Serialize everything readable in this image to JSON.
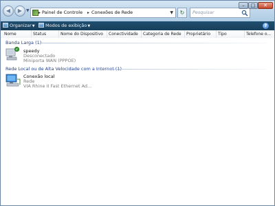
{
  "address_bar": {
    "segments": [
      "Painel de Controle",
      "Conexões de Rede"
    ]
  },
  "search": {
    "placeholder": "Pesquisar"
  },
  "toolbar": {
    "organize": "Organizar",
    "views": "Modos de exibição",
    "help": "?"
  },
  "columns": [
    "Nome",
    "Status",
    "Nome do Dispositivo",
    "Conectividade",
    "Categoria de Rede",
    "Proprietário",
    "Tipo",
    "Telefone o..."
  ],
  "groups": [
    {
      "title": "Banda Larga (1)",
      "items": [
        {
          "name": "speedy",
          "status": "Desconectado",
          "device": "Miniporta WAN (PPPOE)"
        }
      ]
    },
    {
      "title": "Rede Local ou de Alta Velocidade com a Internet (1)",
      "items": [
        {
          "name": "Conexão local",
          "status": "Rede",
          "device": "VIA Rhine II Fast Ethernet Ad..."
        }
      ]
    }
  ],
  "icons": {
    "back": "back-arrow-icon",
    "forward": "forward-arrow-icon",
    "refresh": "refresh-icon",
    "search": "search-icon",
    "help": "help-icon",
    "connection": "network-computer-icon"
  },
  "colors": {
    "toolbar_bg": "#1f4e6e",
    "group_title": "#1e3f8a",
    "status_text": "#7b7b7b",
    "close_button": "#c2462b"
  }
}
